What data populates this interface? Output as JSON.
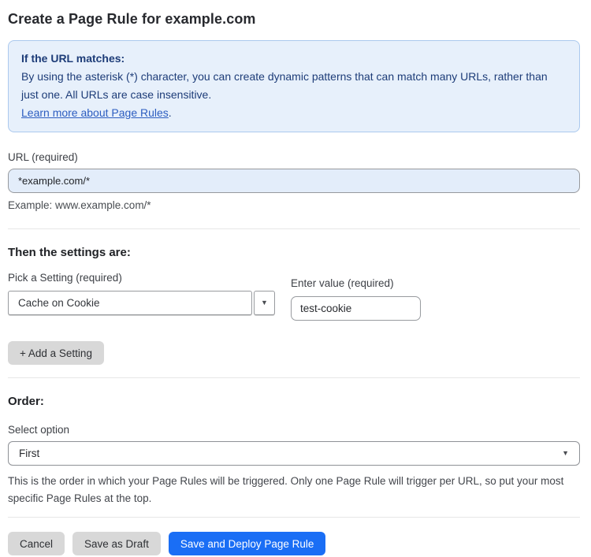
{
  "page_title": "Create a Page Rule for example.com",
  "info_box": {
    "heading": "If the URL matches:",
    "body": "By using the asterisk (*) character, you can create dynamic patterns that can match many URLs, rather than just one. All URLs are case insensitive.",
    "link_label": "Learn more about Page Rules",
    "link_suffix": "."
  },
  "url_field": {
    "label": "URL (required)",
    "value": "*example.com/*",
    "example": "Example: www.example.com/*"
  },
  "settings_section": {
    "heading": "Then the settings are:",
    "setting_picker": {
      "label": "Pick a Setting (required)",
      "selected": "Cache on Cookie"
    },
    "value_field": {
      "label": "Enter value (required)",
      "value": "test-cookie"
    },
    "add_setting_label": "+ Add a Setting"
  },
  "order_section": {
    "heading": "Order:",
    "select_label": "Select option",
    "selected_option": "First",
    "help_text": "This is the order in which your Page Rules will be triggered. Only one Page Rule will trigger per URL, so put your most specific Page Rules at the top."
  },
  "actions": {
    "cancel_label": "Cancel",
    "save_draft_label": "Save as Draft",
    "save_deploy_label": "Save and Deploy Page Rule"
  },
  "icons": {
    "dropdown_arrow": "▼"
  },
  "colors": {
    "primary_button_blue": "#1a6ef5",
    "info_box_bg": "#e7f0fb",
    "info_box_border": "#abc9ee",
    "info_text_navy": "#1d3c78",
    "link_blue": "#2c5dc0",
    "url_input_bg": "#e3edfa",
    "gray_button_bg": "#d8d8d8"
  }
}
